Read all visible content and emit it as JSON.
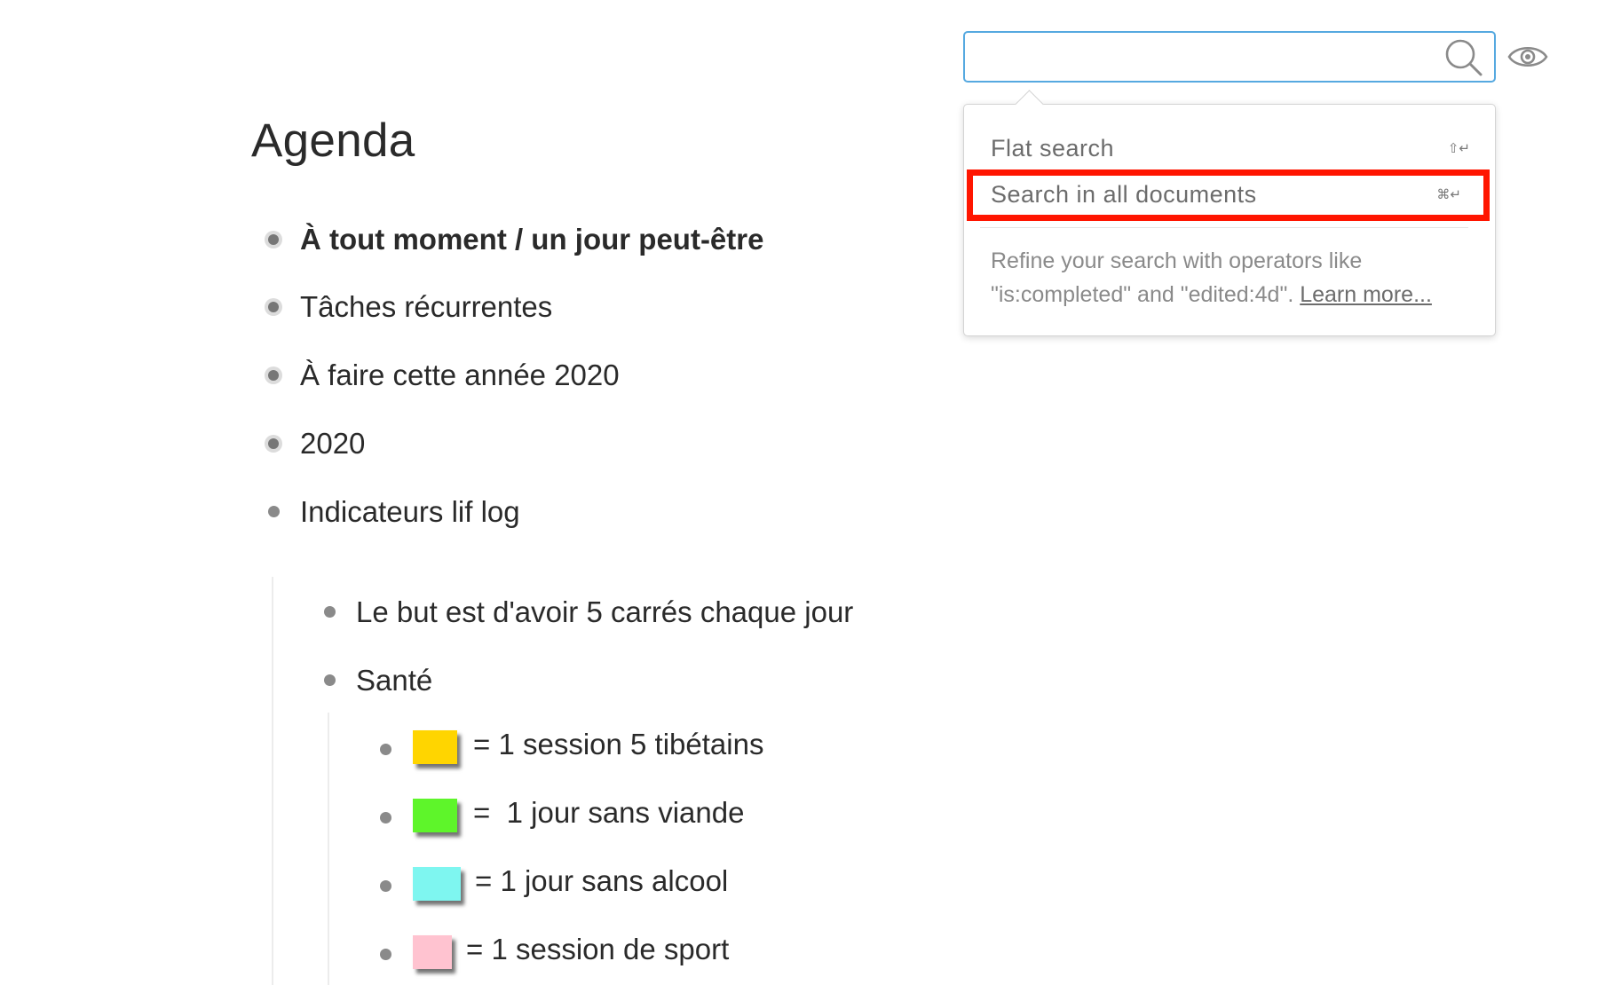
{
  "document": {
    "title": "Agenda",
    "items": [
      {
        "label": "À tout moment / un jour peut-être"
      },
      {
        "label": "Tâches récurrentes"
      },
      {
        "label": "À faire cette année 2020"
      },
      {
        "label": "2020"
      },
      {
        "label": "Indicateurs lif log"
      }
    ],
    "sub_items": [
      {
        "label": "Le but est d'avoir 5 carrés chaque jour"
      },
      {
        "label": "Santé"
      }
    ],
    "legend": [
      {
        "color": "#ffd500",
        "label": "= 1 session 5 tibétains"
      },
      {
        "color": "#5ef52a",
        "label": "=  1 jour sans viande"
      },
      {
        "color": "#7ef6f0",
        "label": "= 1 jour sans alcool"
      },
      {
        "color": "#ffc3d0",
        "label": "= 1 session de sport"
      }
    ]
  },
  "search": {
    "value": "",
    "placeholder": "",
    "icons": {
      "search": "search-icon",
      "toggle": "eye-icon"
    },
    "dropdown": {
      "options": [
        {
          "label": "Flat search",
          "shortcut": "⇧↵"
        },
        {
          "label": "Search in all documents",
          "shortcut": "⌘↵"
        }
      ],
      "hint_text": "Refine your search with operators like \"is:completed\" and \"edited:4d\".",
      "learn_more": "Learn more..."
    }
  },
  "colors": {
    "highlight": "#ff1500",
    "search_border": "#56a9e0"
  }
}
